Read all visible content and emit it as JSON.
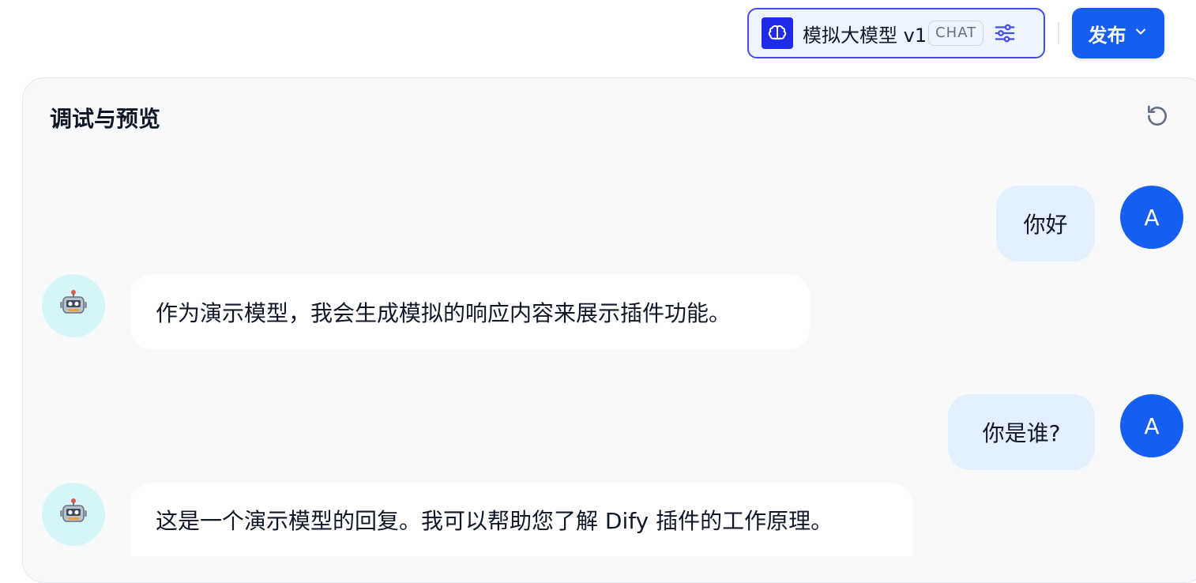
{
  "header": {
    "model": {
      "icon": "brain-icon",
      "name": "模拟大模型 v1",
      "mode_badge": "CHAT",
      "settings_icon": "sliders-icon"
    },
    "publish_label": "发布",
    "publish_icon": "chevron-down-icon"
  },
  "panel": {
    "title": "调试与预览",
    "refresh_icon": "refresh-icon"
  },
  "messages": [
    {
      "role": "user",
      "avatar": "A",
      "text": "你好"
    },
    {
      "role": "assistant",
      "avatar_icon": "robot-icon",
      "text": "作为演示模型，我会生成模拟的响应内容来展示插件功能。"
    },
    {
      "role": "user",
      "avatar": "A",
      "text": "你是谁?"
    },
    {
      "role": "assistant",
      "avatar_icon": "robot-icon",
      "text": "这是一个演示模型的回复。我可以帮助您了解 Dify 插件的工作原理。"
    }
  ],
  "colors": {
    "accent": "#155eef",
    "user_bubble": "#e1effe",
    "bot_avatar_bg": "#d5f5f6",
    "panel_bg": "#f8f9fb"
  }
}
